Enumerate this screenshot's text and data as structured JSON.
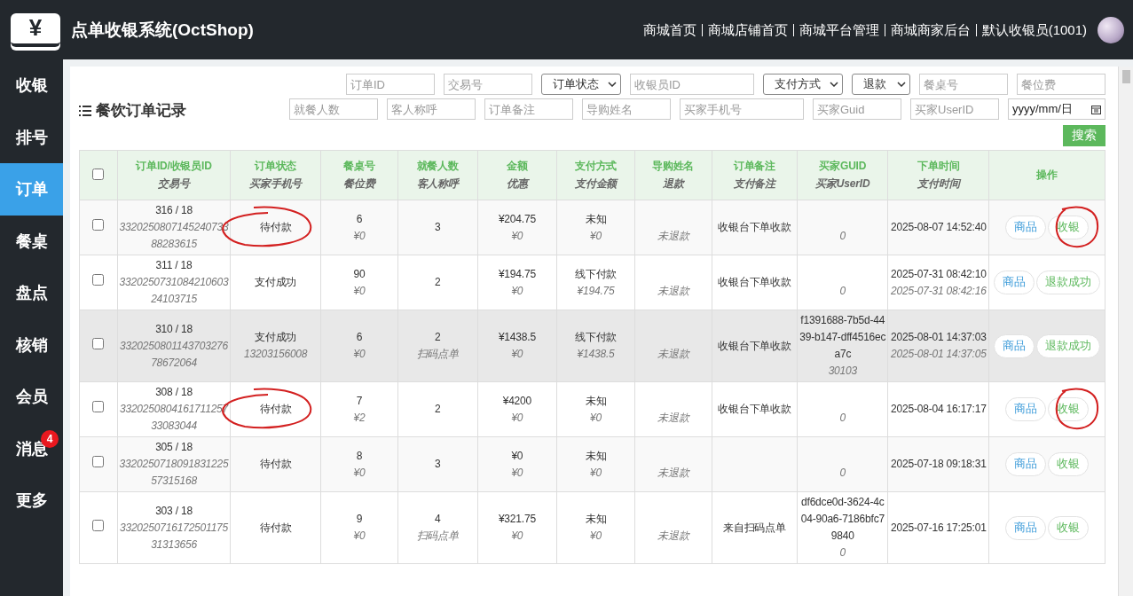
{
  "header": {
    "logo_glyph": "¥",
    "title": "点单收银系统(OctShop)",
    "links": [
      "商城首页",
      "商城店铺首页",
      "商城平台管理",
      "商城商家后台",
      "默认收银员(1001)"
    ]
  },
  "sidebar": {
    "items": [
      {
        "label": "收银",
        "selected": false
      },
      {
        "label": "排号",
        "selected": false
      },
      {
        "label": "订单",
        "selected": true
      },
      {
        "label": "餐桌",
        "selected": false
      },
      {
        "label": "盘点",
        "selected": false
      },
      {
        "label": "核销",
        "selected": false
      },
      {
        "label": "会员",
        "selected": false
      },
      {
        "label": "消息",
        "selected": false,
        "badge": "4"
      },
      {
        "label": "更多",
        "selected": false
      }
    ]
  },
  "panel": {
    "title": "餐饮订单记录",
    "filters": [
      [
        {
          "kind": "input",
          "placeholder": "订单ID"
        },
        {
          "kind": "input",
          "placeholder": "交易号"
        },
        {
          "kind": "select",
          "value": "订单状态"
        },
        {
          "kind": "wide",
          "placeholder": "收银员ID"
        },
        {
          "kind": "select",
          "value": "支付方式"
        },
        {
          "kind": "small",
          "value": "退款"
        },
        {
          "kind": "input",
          "placeholder": "餐桌号"
        },
        {
          "kind": "input",
          "placeholder": "餐位费"
        }
      ],
      [
        {
          "kind": "input",
          "placeholder": "就餐人数"
        },
        {
          "kind": "input",
          "placeholder": "客人称呼"
        },
        {
          "kind": "input",
          "placeholder": "订单备注"
        },
        {
          "kind": "input",
          "placeholder": "导购姓名"
        },
        {
          "kind": "wide",
          "placeholder": "买家手机号"
        },
        {
          "kind": "input",
          "placeholder": "买家Guid"
        },
        {
          "kind": "input",
          "placeholder": "买家UserID"
        },
        {
          "kind": "date",
          "value": "yyyy/mm/日"
        }
      ]
    ],
    "search_button": "搜索"
  },
  "table": {
    "select_all": false,
    "columns": [
      {
        "main": "订单ID/收银员ID",
        "sub": "交易号"
      },
      {
        "main": "订单状态",
        "sub": "买家手机号"
      },
      {
        "main": "餐桌号",
        "sub": "餐位费"
      },
      {
        "main": "就餐人数",
        "sub": "客人称呼"
      },
      {
        "main": "金额",
        "sub": "优惠"
      },
      {
        "main": "支付方式",
        "sub": "支付金额"
      },
      {
        "main": "导购姓名",
        "sub": "退款"
      },
      {
        "main": "订单备注",
        "sub": "支付备注"
      },
      {
        "main": "买家GUID",
        "sub": "买家UserID"
      },
      {
        "main": "下单时间",
        "sub": "支付时间"
      },
      {
        "main": "操作"
      }
    ],
    "rows": [
      {
        "checked": false,
        "highlighted": false,
        "marked": true,
        "cells": [
          {
            "main": "316 / 18",
            "sub": "332025080714524073388283615"
          },
          {
            "main": "待付款"
          },
          {
            "main": "6",
            "sub": "¥0"
          },
          {
            "main": "3"
          },
          {
            "main": "¥204.75",
            "sub": "¥0"
          },
          {
            "main": "未知",
            "sub": "¥0"
          },
          {
            "sub": "未退款"
          },
          {
            "main": "收银台下单收款"
          },
          {
            "sub": "0"
          },
          {
            "main": "2025-08-07 14:52:40"
          }
        ],
        "buttons": [
          {
            "label": "商品",
            "kind": "goods"
          },
          {
            "label": "收银",
            "kind": "pay"
          }
        ]
      },
      {
        "checked": false,
        "highlighted": false,
        "marked": false,
        "cells": [
          {
            "main": "311 / 18",
            "sub": "332025073108421060324103715"
          },
          {
            "main": "支付成功"
          },
          {
            "main": "90",
            "sub": "¥0"
          },
          {
            "main": "2"
          },
          {
            "main": "¥194.75",
            "sub": "¥0"
          },
          {
            "main": "线下付款",
            "sub": "¥194.75"
          },
          {
            "sub": "未退款"
          },
          {
            "main": "收银台下单收款"
          },
          {
            "sub": "0"
          },
          {
            "main": "2025-07-31 08:42:10",
            "sub": "2025-07-31 08:42:16"
          }
        ],
        "buttons": [
          {
            "label": "商品",
            "kind": "goods"
          },
          {
            "label": "退款成功",
            "kind": "refund"
          }
        ]
      },
      {
        "checked": false,
        "highlighted": true,
        "marked": false,
        "cells": [
          {
            "main": "310 / 18",
            "sub": "332025080114370327678672064"
          },
          {
            "main": "支付成功",
            "sub": "13203156008"
          },
          {
            "main": "6",
            "sub": "¥0"
          },
          {
            "main": "2",
            "sub": "扫码点单"
          },
          {
            "main": "¥1438.5",
            "sub": "¥0"
          },
          {
            "main": "线下付款",
            "sub": "¥1438.5"
          },
          {
            "sub": "未退款"
          },
          {
            "main": "收银台下单收款"
          },
          {
            "main": "f1391688-7b5d-4439-b147-dff4516eca7c",
            "sub": "30103"
          },
          {
            "main": "2025-08-01 14:37:03",
            "sub": "2025-08-01 14:37:05"
          }
        ],
        "buttons": [
          {
            "label": "商品",
            "kind": "goods"
          },
          {
            "label": "退款成功",
            "kind": "refund"
          }
        ]
      },
      {
        "checked": false,
        "highlighted": false,
        "marked": true,
        "cells": [
          {
            "main": "308 / 18",
            "sub": "332025080416171125733083044"
          },
          {
            "main": "待付款"
          },
          {
            "main": "7",
            "sub": "¥2"
          },
          {
            "main": "2"
          },
          {
            "main": "¥4200",
            "sub": "¥0"
          },
          {
            "main": "未知",
            "sub": "¥0"
          },
          {
            "sub": "未退款"
          },
          {
            "main": "收银台下单收款"
          },
          {
            "sub": "0"
          },
          {
            "main": "2025-08-04 16:17:17"
          }
        ],
        "buttons": [
          {
            "label": "商品",
            "kind": "goods"
          },
          {
            "label": "收银",
            "kind": "pay"
          }
        ]
      },
      {
        "checked": false,
        "highlighted": false,
        "marked": false,
        "cells": [
          {
            "main": "305 / 18",
            "sub": "332025071809183122557315168"
          },
          {
            "main": "待付款"
          },
          {
            "main": "8",
            "sub": "¥0"
          },
          {
            "main": "3"
          },
          {
            "main": "¥0",
            "sub": "¥0"
          },
          {
            "main": "未知",
            "sub": "¥0"
          },
          {
            "sub": "未退款"
          },
          {},
          {
            "sub": "0"
          },
          {
            "main": "2025-07-18 09:18:31"
          }
        ],
        "buttons": [
          {
            "label": "商品",
            "kind": "goods"
          },
          {
            "label": "收银",
            "kind": "pay"
          }
        ]
      },
      {
        "checked": false,
        "highlighted": false,
        "marked": false,
        "cells": [
          {
            "main": "303 / 18",
            "sub": "332025071617250117531313656"
          },
          {
            "main": "待付款"
          },
          {
            "main": "9",
            "sub": "¥0"
          },
          {
            "main": "4",
            "sub": "扫码点单"
          },
          {
            "main": "¥321.75",
            "sub": "¥0"
          },
          {
            "main": "未知",
            "sub": "¥0"
          },
          {
            "sub": "未退款"
          },
          {
            "main": "来自扫码点单"
          },
          {
            "main": "df6dce0d-3624-4c04-90a6-7186bfc79840",
            "sub": "0"
          },
          {
            "main": "2025-07-16 17:25:01"
          }
        ],
        "buttons": [
          {
            "label": "商品",
            "kind": "goods"
          },
          {
            "label": "收银",
            "kind": "pay"
          }
        ]
      }
    ]
  }
}
